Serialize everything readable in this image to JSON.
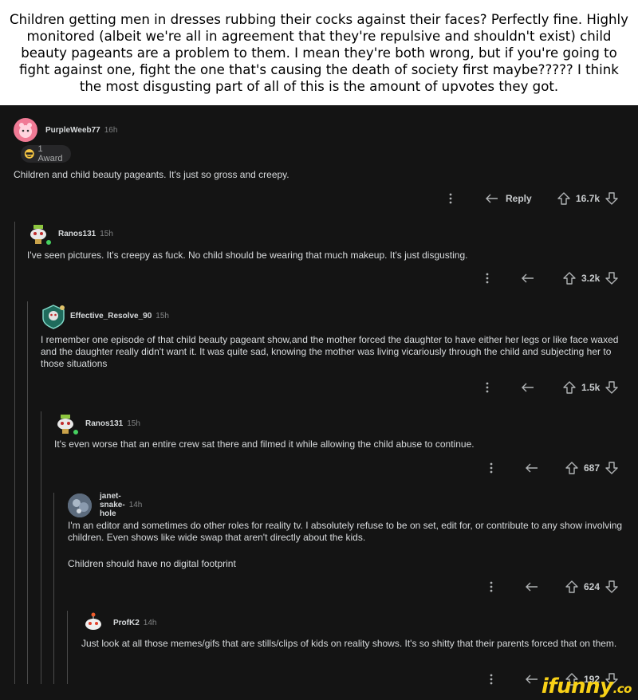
{
  "caption": "Children getting men in dresses rubbing their cocks against their faces? Perfectly fine. Highly monitored (albeit we're all in agreement that they're repulsive and shouldn't exist) child beauty pageants are a problem to them. I mean they're both wrong, but if you're going to fight against one, fight the one that's causing the death of society first maybe????? I think the most disgusting part of all of this is the amount of upvotes they got.",
  "comments": [
    {
      "user": "PurpleWeeb77",
      "time": "16h",
      "award": "1 Award",
      "text": "Children and child beauty pageants. It's just so gross and creepy.",
      "reply_label": "Reply",
      "score": "16.7k"
    },
    {
      "user": "Ranos131",
      "time": "15h",
      "text": "I've seen pictures. It's creepy as fuck. No child should be wearing that much makeup. It's just disgusting.",
      "score": "3.2k"
    },
    {
      "user": "Effective_Resolve_90",
      "time": "15h",
      "text": "I remember one episode of that child beauty pageant show,and the mother forced the daughter to have either her legs or like face waxed and the daughter really didn't want it. It was quite sad, knowing the mother was living vicariously through the child and subjecting her to those situations",
      "score": "1.5k"
    },
    {
      "user": "Ranos131",
      "time": "15h",
      "text": "It's even worse that an entire crew sat there and filmed it while allowing the child abuse to continue.",
      "score": "687"
    },
    {
      "user": "janet-snake-hole",
      "time": "14h",
      "text": "I'm an editor and sometimes do other roles for reality tv. I absolutely refuse to be on set, edit for, or contribute to any show involving children. Even shows like wide swap that aren't directly about the kids.",
      "text2": "Children should have no digital footprint",
      "score": "624"
    },
    {
      "user": "ProfK2",
      "time": "14h",
      "text": "Just look at all those memes/gifs that are stills/clips of kids on reality shows. It's so shitty that their parents forced that on them.",
      "score": "192"
    }
  ],
  "watermark": {
    "main": "ifunny",
    "suffix": ".co"
  },
  "colors": {
    "online": "#46d160",
    "watermark": "#f8d117"
  }
}
